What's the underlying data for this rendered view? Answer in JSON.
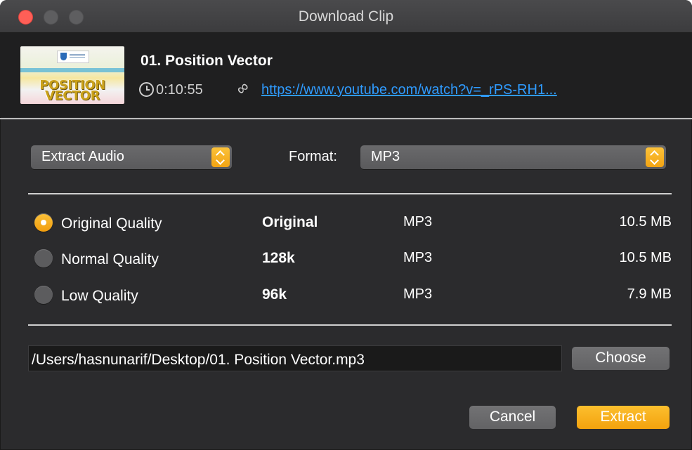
{
  "window": {
    "title": "Download Clip"
  },
  "clip": {
    "thumbnail_text": "POSITION VECTOR",
    "title": "01. Position Vector",
    "duration": "0:10:55",
    "url": "https://www.youtube.com/watch?v=_rPS-RH1..."
  },
  "mode_select": {
    "value": "Extract Audio"
  },
  "format": {
    "label": "Format:",
    "value": "MP3"
  },
  "qualities": [
    {
      "label": "Original Quality",
      "bitrate": "Original",
      "format": "MP3",
      "size": "10.5 MB",
      "selected": true
    },
    {
      "label": "Normal Quality",
      "bitrate": "128k",
      "format": "MP3",
      "size": "10.5 MB",
      "selected": false
    },
    {
      "label": "Low Quality",
      "bitrate": "96k",
      "format": "MP3",
      "size": "7.9 MB",
      "selected": false
    }
  ],
  "output": {
    "path": "/Users/hasnunarif/Desktop/01. Position Vector.mp3",
    "choose_label": "Choose"
  },
  "actions": {
    "cancel_label": "Cancel",
    "extract_label": "Extract"
  },
  "colors": {
    "accent": "#f5a918",
    "link": "#2f9bff",
    "close": "#fe5f57"
  }
}
